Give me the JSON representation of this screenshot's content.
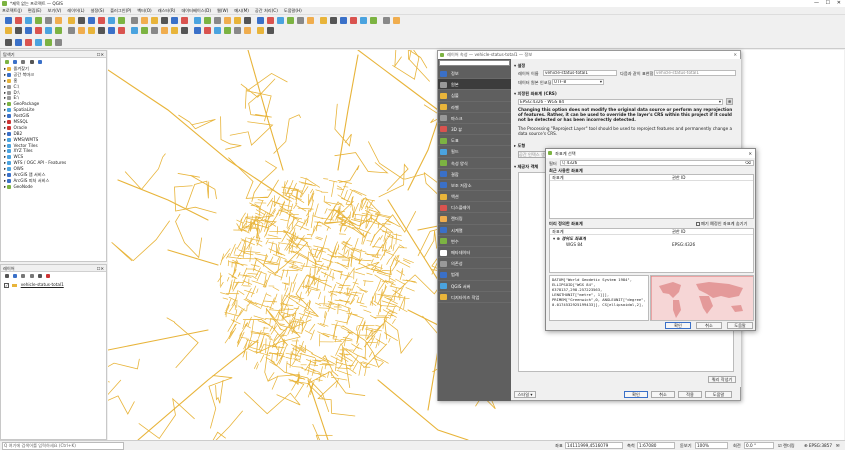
{
  "window": {
    "title": "*제목 없는 프로젝트 — QGIS"
  },
  "menubar": [
    "프로젝트(J)",
    "편집(E)",
    "보기(V)",
    "레이어(L)",
    "설정(S)",
    "플러그인(P)",
    "벡터(O)",
    "래스터(R)",
    "데이터베이스(D)",
    "웹(W)",
    "메시(M)",
    "공간 처리(C)",
    "도움말(H)"
  ],
  "browser": {
    "title": "탐색기",
    "items": [
      "즐겨찾기",
      "공간 북마크",
      "홈",
      "C:\\",
      "D:\\",
      "E:\\",
      "GeoPackage",
      "SpatiaLite",
      "PostGIS",
      "MSSQL",
      "Oracle",
      "DB2",
      "WMS/WMTS",
      "Vector Tiles",
      "XYZ Tiles",
      "WCS",
      "WFS / OGC API - Features",
      "OWS",
      "ArcGIS 맵 서비스",
      "ArcGIS 피처 서비스",
      "GeoNode"
    ]
  },
  "layers": {
    "title": "레이어",
    "items": [
      {
        "name": "vehicle-status-total1",
        "checked": true
      }
    ]
  },
  "props": {
    "title": "레이어 속성 — vehicle-status-total1 — 정보",
    "search_placeholder": "",
    "nav": [
      "정보",
      "원본",
      "심볼",
      "라벨",
      "마스크",
      "3D 뷰",
      "도표",
      "필드",
      "속성 양식",
      "결합",
      "보조 저장소",
      "액션",
      "디스플레이",
      "렌더링",
      "시계열",
      "변수",
      "메타데이터",
      "의존성",
      "범례",
      "QGIS 서버",
      "디지타이즈 작업"
    ],
    "selected_nav": 1,
    "settings_title": "설정",
    "layer_name_label": "레이어 이름",
    "layer_name_value": "vehicle-status-total1",
    "display_as_label": "다음과 같이 표현함",
    "display_as_value": "vehicle-status-total1",
    "encoding_label": "데이터 원본 인코딩",
    "encoding_value": "UTF-8",
    "crs_title": "지정된 좌표계 (CRS)",
    "crs_value": "EPSG:4326 - WGS 84",
    "crs_warn": "Changing this option does not modify the original data source or perform any reprojection of features. Rather, it can be used to override the layer's CRS within this project if it could not be detected or has been incorrectly detected.",
    "crs_note": "The Processing \"Reproject Layer\" tool should be used to reproject features and permanently change a data source's CRS.",
    "geom_title": "도형",
    "query_title": "제공자 객체",
    "query_button": "공간 인덱스 생성",
    "query_builder": "쿼리 작성기",
    "style_button": "스타일",
    "ok": "확인",
    "cancel": "취소",
    "apply": "적용",
    "help": "도움말"
  },
  "crsdialog": {
    "title": "좌표계 선택",
    "filter_label": "필터",
    "filter_value": "4326",
    "recent_title": "최근 사용한 좌표계",
    "col_crs": "좌표계",
    "col_auth": "권한 ID",
    "predef_title": "미리 정의한 좌표계",
    "hide_deprecated": "폐기 예정인 좌표계 숨기기",
    "group": "경위도 좌표계",
    "row_name": "WGS 84",
    "row_auth": "EPSG:4326",
    "wkt": "DATUM[\"World Geodetic System 1984\", ELLIPSOID[\"WGS 84\", 6378137,298.257223563, LENGTHUNIT[\"metre\", 1]]], PRIMEM[\"Greenwich\",0, ANGLEUNIT[\"degree\", 0.0174532925199433]], CS[ellipsoidal,2],",
    "ok": "확인",
    "cancel": "취소",
    "help": "도움말"
  },
  "statusbar": {
    "search_placeholder": "Q 여기에 검색어를 입력하세요 (Ctrl+K)",
    "coord_label": "좌표",
    "coord_value": "14111999,4516079",
    "scale_label": "축척",
    "scale_value": "1:67080",
    "magnifier_label": "돋보기",
    "magnifier_value": "100%",
    "rotation_label": "회전",
    "rotation_value": "0.0 °",
    "render_label": "렌더링",
    "epsg": "EPSG:3857"
  },
  "colors": {
    "roads": "#e8b43a",
    "nav_bg": "#5f5f5f",
    "nav_sel": "#3c3c3c",
    "accent": "#3a70c8"
  }
}
